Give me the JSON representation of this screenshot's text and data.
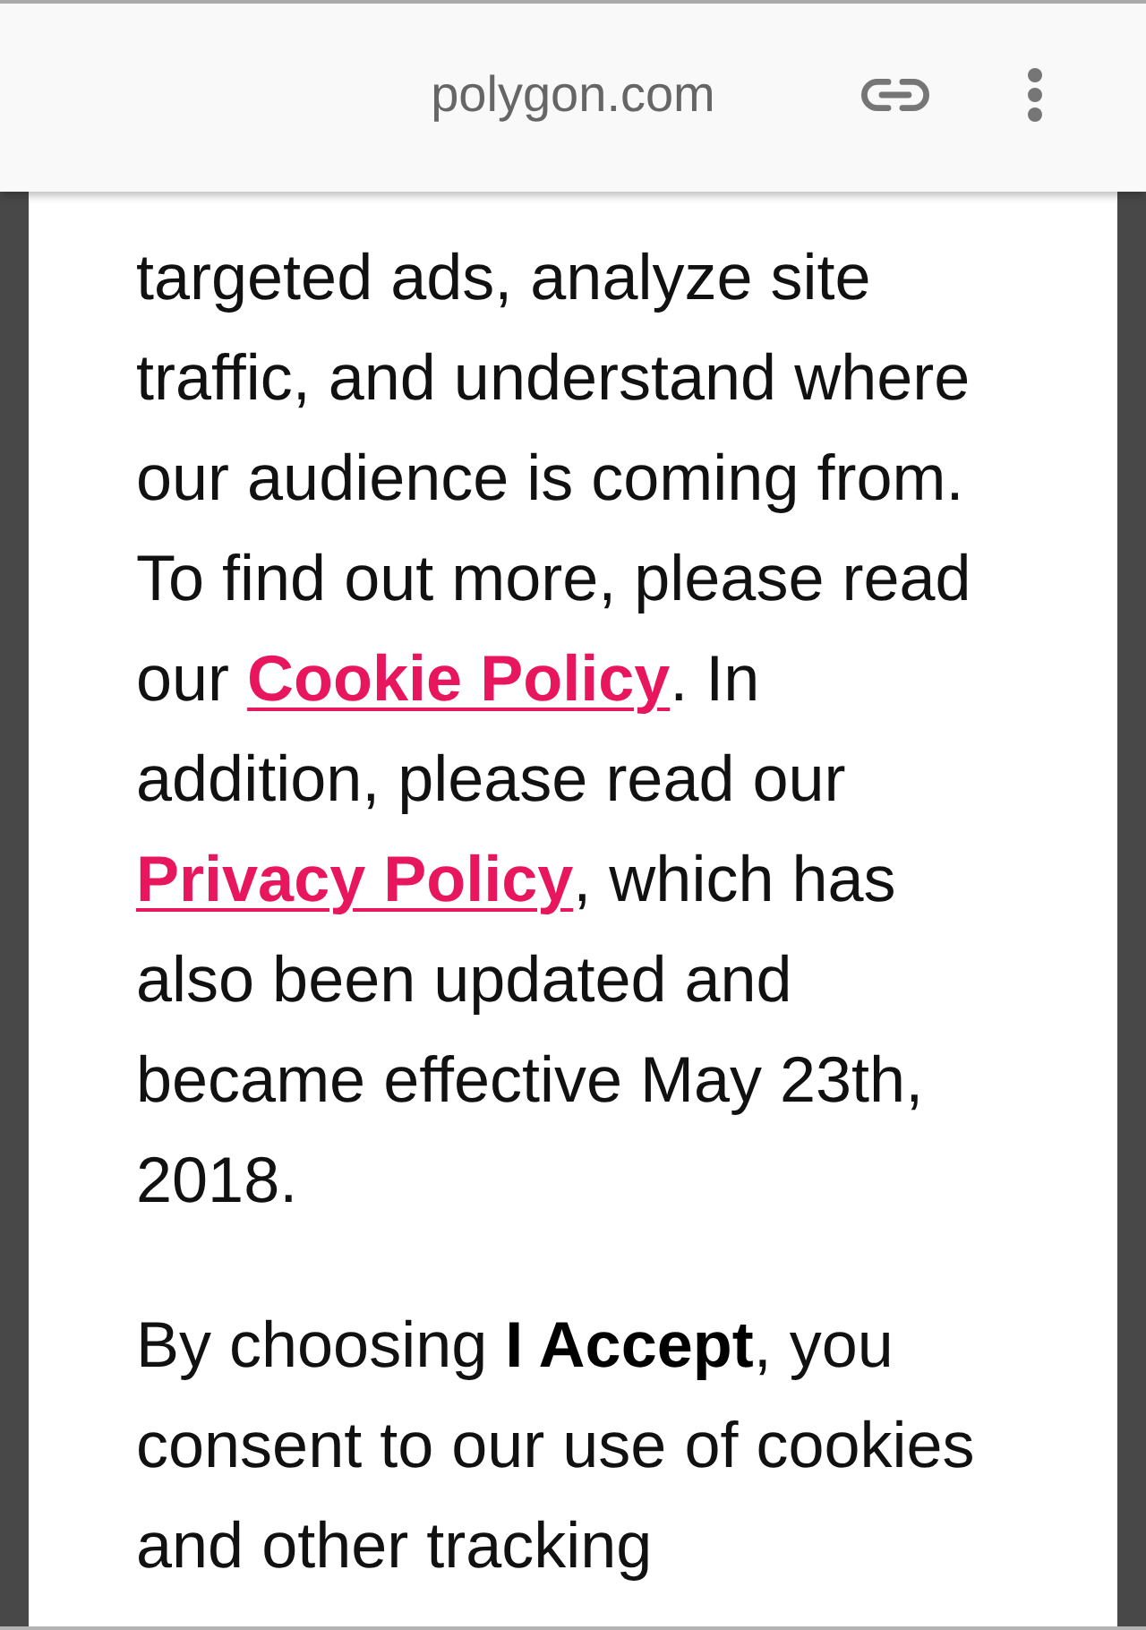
{
  "browser_bar": {
    "url": "polygon.com"
  },
  "notice": {
    "paragraphs": [
      {
        "parts": [
          {
            "kind": "text",
            "text": "targeted ads, analyze site traffic, and understand where our audience is coming from. To find out more, please read our "
          },
          {
            "kind": "link",
            "text": "Cookie Policy"
          },
          {
            "kind": "text",
            "text": ". In addition, please read our "
          },
          {
            "kind": "link",
            "text": "Privacy Policy"
          },
          {
            "kind": "text",
            "text": ", which has also been updated and became effective May 23th, 2018."
          }
        ]
      },
      {
        "parts": [
          {
            "kind": "text",
            "text": "By choosing **I Accept**, you consent to our use of cookies and other tracking"
          }
        ]
      }
    ]
  }
}
